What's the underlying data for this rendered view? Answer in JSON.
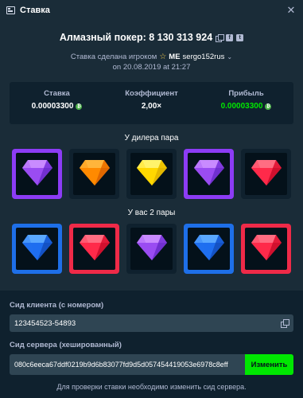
{
  "header": {
    "title": "Ставка",
    "close_glyph": "✕"
  },
  "game": {
    "title": "Алмазный покер: 8 130 313 924",
    "placed_by": "Ставка сделана игроком",
    "user_prefix": "ME",
    "username": "sergo152rus",
    "date": "on 20.08.2019 at 21:27"
  },
  "stats": {
    "bet_label": "Ставка",
    "bet_value": "0.00003300",
    "multiplier_label": "Коэффициент",
    "multiplier_value": "2,00×",
    "profit_label": "Прибыль",
    "profit_value": "0.00003300"
  },
  "dealer": {
    "label": "У дилера пара",
    "cards": [
      {
        "gem": "purple",
        "highlight": "purple"
      },
      {
        "gem": "orange",
        "highlight": "none"
      },
      {
        "gem": "yellow",
        "highlight": "none"
      },
      {
        "gem": "purple",
        "highlight": "purple"
      },
      {
        "gem": "red",
        "highlight": "none"
      }
    ]
  },
  "player": {
    "label": "У вас 2 пары",
    "cards": [
      {
        "gem": "blue",
        "highlight": "blue"
      },
      {
        "gem": "red",
        "highlight": "red"
      },
      {
        "gem": "purple",
        "highlight": "none"
      },
      {
        "gem": "blue",
        "highlight": "blue"
      },
      {
        "gem": "red",
        "highlight": "red"
      }
    ]
  },
  "gem_colors": {
    "purple": [
      "#c98bff",
      "#9a4cf2",
      "#7130d0"
    ],
    "orange": [
      "#ffb53b",
      "#ff8a00",
      "#e06800"
    ],
    "yellow": [
      "#fff36b",
      "#ffd800",
      "#e3b800"
    ],
    "red": [
      "#ff6d82",
      "#ff2a4a",
      "#d1102e"
    ],
    "blue": [
      "#5aa8ff",
      "#1f6ff0",
      "#1452c4"
    ]
  },
  "seeds": {
    "client_label": "Сид клиента (с номером)",
    "client_value": "123454523-54893",
    "server_label": "Сид сервера (хешированный)",
    "server_value": "080c6eeca67ddf0219b9d6b83077fd9d5d057454419053e6978c8eff",
    "change_button": "Изменить",
    "note": "Для проверки ставки необходимо изменить сид сервера."
  },
  "icons": {
    "header": "bets-icon",
    "copy": "copy-icon",
    "facebook": "facebook-icon",
    "twitter": "twitter-icon",
    "star": "star-icon",
    "coin": "bitcoin-icon"
  }
}
